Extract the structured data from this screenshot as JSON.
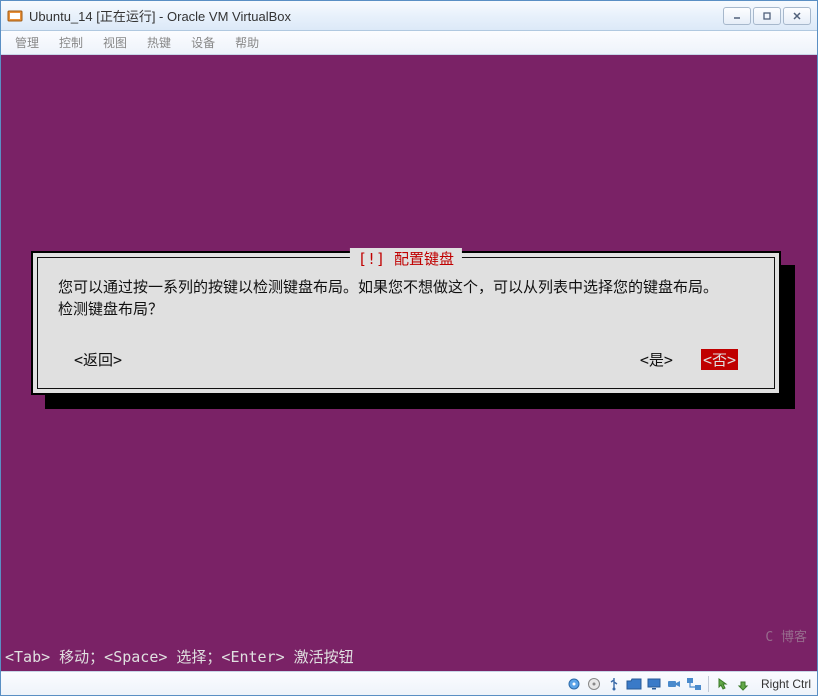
{
  "window": {
    "title": "Ubuntu_14 [正在运行] - Oracle VM VirtualBox"
  },
  "menubar": {
    "items": [
      "管理",
      "控制",
      "视图",
      "热键",
      "设备",
      "帮助"
    ]
  },
  "dialog": {
    "title_prefix": "[!]",
    "title": "配置键盘",
    "line1": "您可以通过按一系列的按键以检测键盘布局。如果您不想做这个，可以从列表中选择您的键盘布局。",
    "line2": "检测键盘布局？",
    "back": "<返回>",
    "yes": "<是>",
    "no": "<否>"
  },
  "hint": "<Tab> 移动；<Space> 选择；<Enter> 激活按钮",
  "statusbar": {
    "host_key": "Right Ctrl"
  },
  "watermark": "C 博客"
}
